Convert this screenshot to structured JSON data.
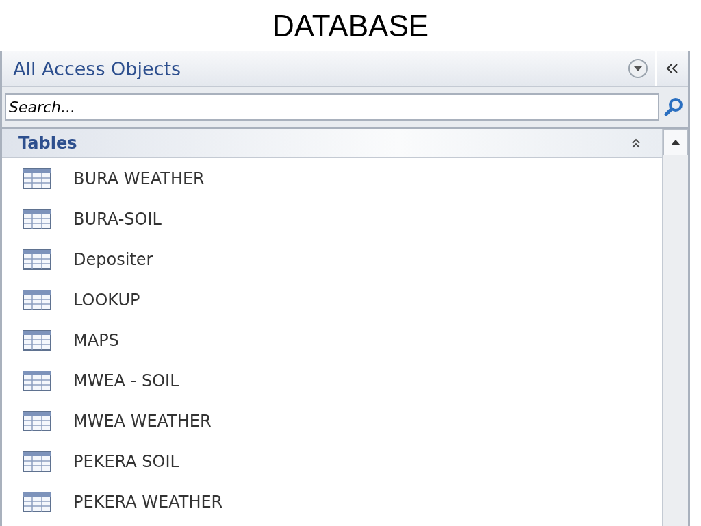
{
  "slide_title": "DATABASE",
  "pane": {
    "title": "All Access Objects",
    "search": {
      "placeholder": "Search..."
    },
    "group": {
      "title": "Tables",
      "expanded": true,
      "items": [
        {
          "label": "BURA WEATHER"
        },
        {
          "label": "BURA-SOIL"
        },
        {
          "label": "Depositer"
        },
        {
          "label": "LOOKUP"
        },
        {
          "label": "MAPS"
        },
        {
          "label": "MWEA - SOIL"
        },
        {
          "label": "MWEA WEATHER"
        },
        {
          "label": "PEKERA SOIL"
        },
        {
          "label": "PEKERA WEATHER"
        }
      ]
    }
  }
}
